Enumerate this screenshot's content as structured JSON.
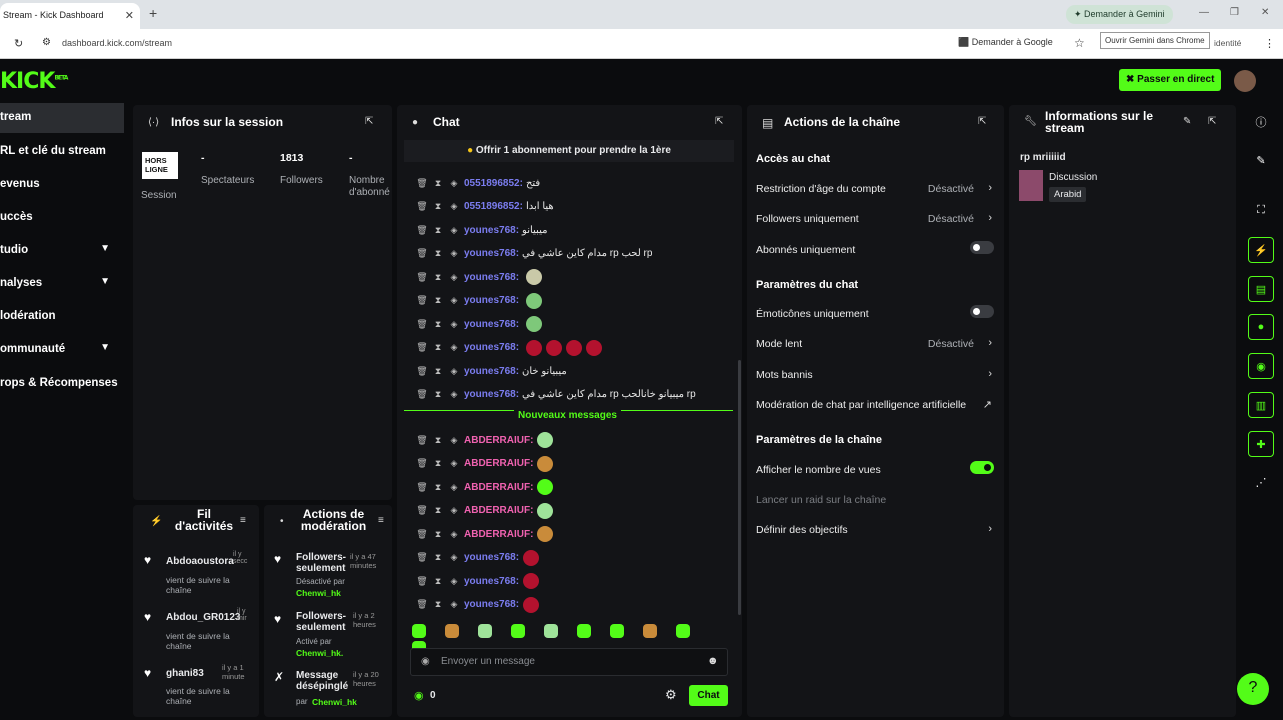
{
  "browser": {
    "tab_title": "Stream - Kick Dashboard",
    "url": "dashboard.kick.com/stream",
    "gemini_btn": "Demander à Gemini",
    "gemini_tooltip": "Ouvrir Gemini dans Chrome",
    "ask_google": "Demander à Google",
    "identity": "identité"
  },
  "app": {
    "logo": "KICK",
    "logo_badge": "BETA",
    "go_live": "Passer en direct"
  },
  "sidebar": {
    "items": [
      {
        "label": "tream"
      },
      {
        "label": "RL et clé du stream"
      },
      {
        "label": "evenus"
      },
      {
        "label": "uccès"
      },
      {
        "label": "tudio"
      },
      {
        "label": "nalyses"
      },
      {
        "label": "lodération"
      },
      {
        "label": "ommunauté"
      },
      {
        "label": "rops & Récompenses"
      }
    ]
  },
  "session": {
    "title": "Infos sur la session",
    "status_badge": "HORS LIGNE",
    "session_label": "Session",
    "viewers_value": "-",
    "viewers_label": "Spectateurs",
    "followers_value": "1813",
    "followers_label": "Followers",
    "subs_value": "-",
    "subs_label": "Nombre d'abonné"
  },
  "chat": {
    "title": "Chat",
    "pinned": "Offrir 1 abonnement pour prendre la 1ère",
    "new_messages": "Nouveaux messages",
    "messages": [
      {
        "user": "0551896852:",
        "text": "فتح",
        "color": "#7b7df0"
      },
      {
        "user": "0551896852:",
        "text": "هيا ابدا",
        "color": "#7b7df0"
      },
      {
        "user": "younes768:",
        "text": "ميبيانو",
        "color": "#7b7df0"
      },
      {
        "user": "younes768:",
        "text": "مدام كاين عاشي في rp لحب rp",
        "color": "#7b7df0"
      },
      {
        "user": "younes768:",
        "text": "",
        "color": "#7b7df0"
      },
      {
        "user": "younes768:",
        "text": "",
        "color": "#7b7df0"
      },
      {
        "user": "younes768:",
        "text": "",
        "color": "#7b7df0"
      },
      {
        "user": "younes768:",
        "text": "",
        "color": "#7b7df0"
      },
      {
        "user": "younes768:",
        "text": "ميبيانو خان",
        "color": "#7b7df0"
      },
      {
        "user": "younes768:",
        "text": "مدام كاين عاشي في rp ميبيانو خانالحب rp",
        "color": "#7b7df0"
      }
    ],
    "new": [
      {
        "user": "ABDERRAIUF:",
        "color": "#f062b0"
      },
      {
        "user": "ABDERRAIUF:",
        "color": "#f062b0"
      },
      {
        "user": "ABDERRAIUF:",
        "color": "#f062b0"
      },
      {
        "user": "ABDERRAIUF:",
        "color": "#f062b0"
      },
      {
        "user": "ABDERRAIUF:",
        "color": "#f062b0"
      },
      {
        "user": "younes768:",
        "color": "#7b7df0"
      },
      {
        "user": "younes768:",
        "color": "#7b7df0"
      },
      {
        "user": "younes768:",
        "color": "#7b7df0"
      }
    ],
    "input_placeholder": "Envoyer un message",
    "points": "0",
    "send_label": "Chat"
  },
  "actions": {
    "title": "Actions de la chaîne",
    "sec_chat_access": "Accès au chat",
    "age_restriction": "Restriction d'âge du compte",
    "age_restriction_value": "Désactivé",
    "followers_only": "Followers uniquement",
    "followers_only_value": "Désactivé",
    "subs_only": "Abonnés uniquement",
    "sec_chat_settings": "Paramètres du chat",
    "emotes_only": "Émoticônes uniquement",
    "slow_mode": "Mode lent",
    "slow_mode_value": "Désactivé",
    "banned_words": "Mots bannis",
    "ai_moderation": "Modération de chat par intelligence artificielle",
    "sec_channel_settings": "Paramètres de la chaîne",
    "show_views": "Afficher le nombre de vues",
    "raid": "Lancer un raid sur la chaîne",
    "goals": "Définir des objectifs"
  },
  "stream_info": {
    "title": "Informations sur le stream",
    "stream_title": "rp mriiiiid",
    "category": "Discussion",
    "tag": "Arabid"
  },
  "activity": {
    "title": "Fil d'activités",
    "items": [
      {
        "user": "Abdoaoustora",
        "time": "il y secc",
        "text": "vient de suivre la chaîne"
      },
      {
        "user": "Abdou_GR0123",
        "time": "il y mir",
        "text": "vient de suivre la chaîne"
      },
      {
        "user": "ghani83",
        "time": "il y a 1 minute",
        "text": "vient de suivre la chaîne"
      }
    ]
  },
  "moderation": {
    "title": "Actions de modération",
    "items": [
      {
        "action": "Followers-seulement",
        "time": "il y a 47 minutes",
        "detail": "Désactivé par",
        "by": "Chenwi_hk"
      },
      {
        "action": "Followers-seulement",
        "time": "il y a 2 heures",
        "detail": "Activé par",
        "by": "Chenwi_hk."
      },
      {
        "action": "Message désépinglé",
        "time": "il y a 20 heures",
        "detail": "par",
        "by": "Chenwi_hk"
      }
    ]
  }
}
